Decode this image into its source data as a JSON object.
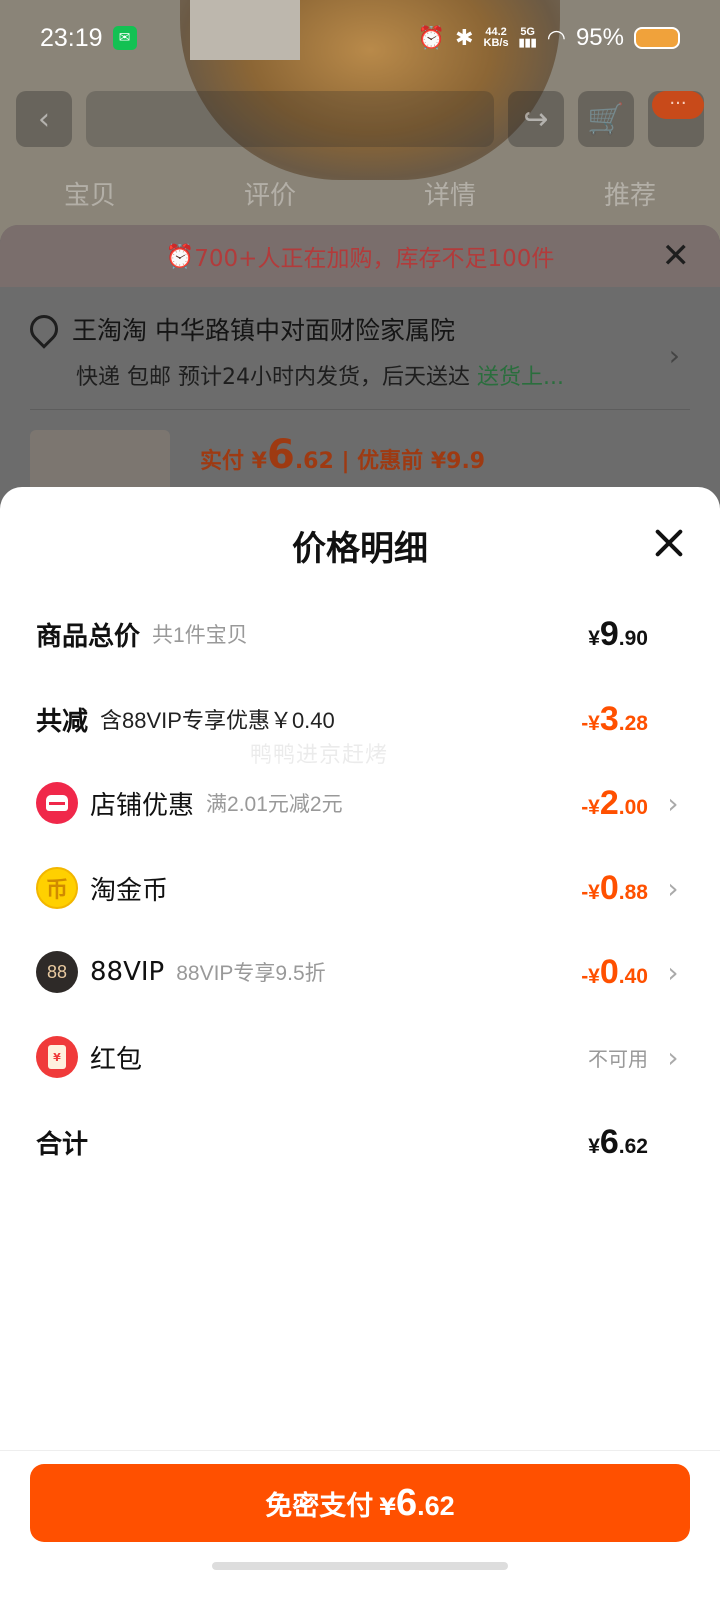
{
  "status_bar": {
    "time": "23:19",
    "net_speed_value": "44.2",
    "net_speed_unit": "KB/s",
    "network": "5G",
    "battery": "95%"
  },
  "background": {
    "tabs": [
      "宝贝",
      "评价",
      "详情",
      "推荐"
    ],
    "alert_text": "700+人正在加购，库存不足100件",
    "address_line1": "王淘淘 中华路镇中对面财险家属院",
    "address_line2": "快递 包邮 预计24小时内发货，后天送达",
    "address_link": "送货上...",
    "price_prefix": "实付 ¥",
    "price_int": "6",
    "price_dec": ".62",
    "price_original": "| 优惠前 ¥9.9"
  },
  "sheet": {
    "title": "价格明细",
    "watermark": "鸭鸭进京赶烤",
    "rows": {
      "total": {
        "label": "商品总价",
        "sub": "共1件宝贝",
        "cur": "¥",
        "int": "9",
        "dec": ".90"
      },
      "discount": {
        "label": "共减",
        "sub": "含88VIP专享优惠￥0.40",
        "cur": "-¥",
        "int": "3",
        "dec": ".28"
      },
      "shop": {
        "label": "店铺优惠",
        "sub": "满2.01元减2元",
        "cur": "-¥",
        "int": "2",
        "dec": ".00"
      },
      "coins": {
        "label": "淘金币",
        "cur": "-¥",
        "int": "0",
        "dec": ".88"
      },
      "vip": {
        "label": "88VIP",
        "sub": "88VIP专享9.5折",
        "cur": "-¥",
        "int": "0",
        "dec": ".40",
        "icon_text": "88"
      },
      "hongbao": {
        "label": "红包",
        "status": "不可用",
        "icon_text": "¥"
      },
      "sum": {
        "label": "合计",
        "cur": "¥",
        "int": "6",
        "dec": ".62"
      }
    },
    "pay_button": {
      "label": "免密支付",
      "cur": "¥",
      "int": "6",
      "dec": ".62"
    }
  },
  "colors": {
    "accent": "#ff5000",
    "shop_icon": "#f0284a",
    "coin_icon": "#ffd000",
    "vip_icon": "#2e2a28",
    "hongbao_icon": "#f03a3a"
  }
}
